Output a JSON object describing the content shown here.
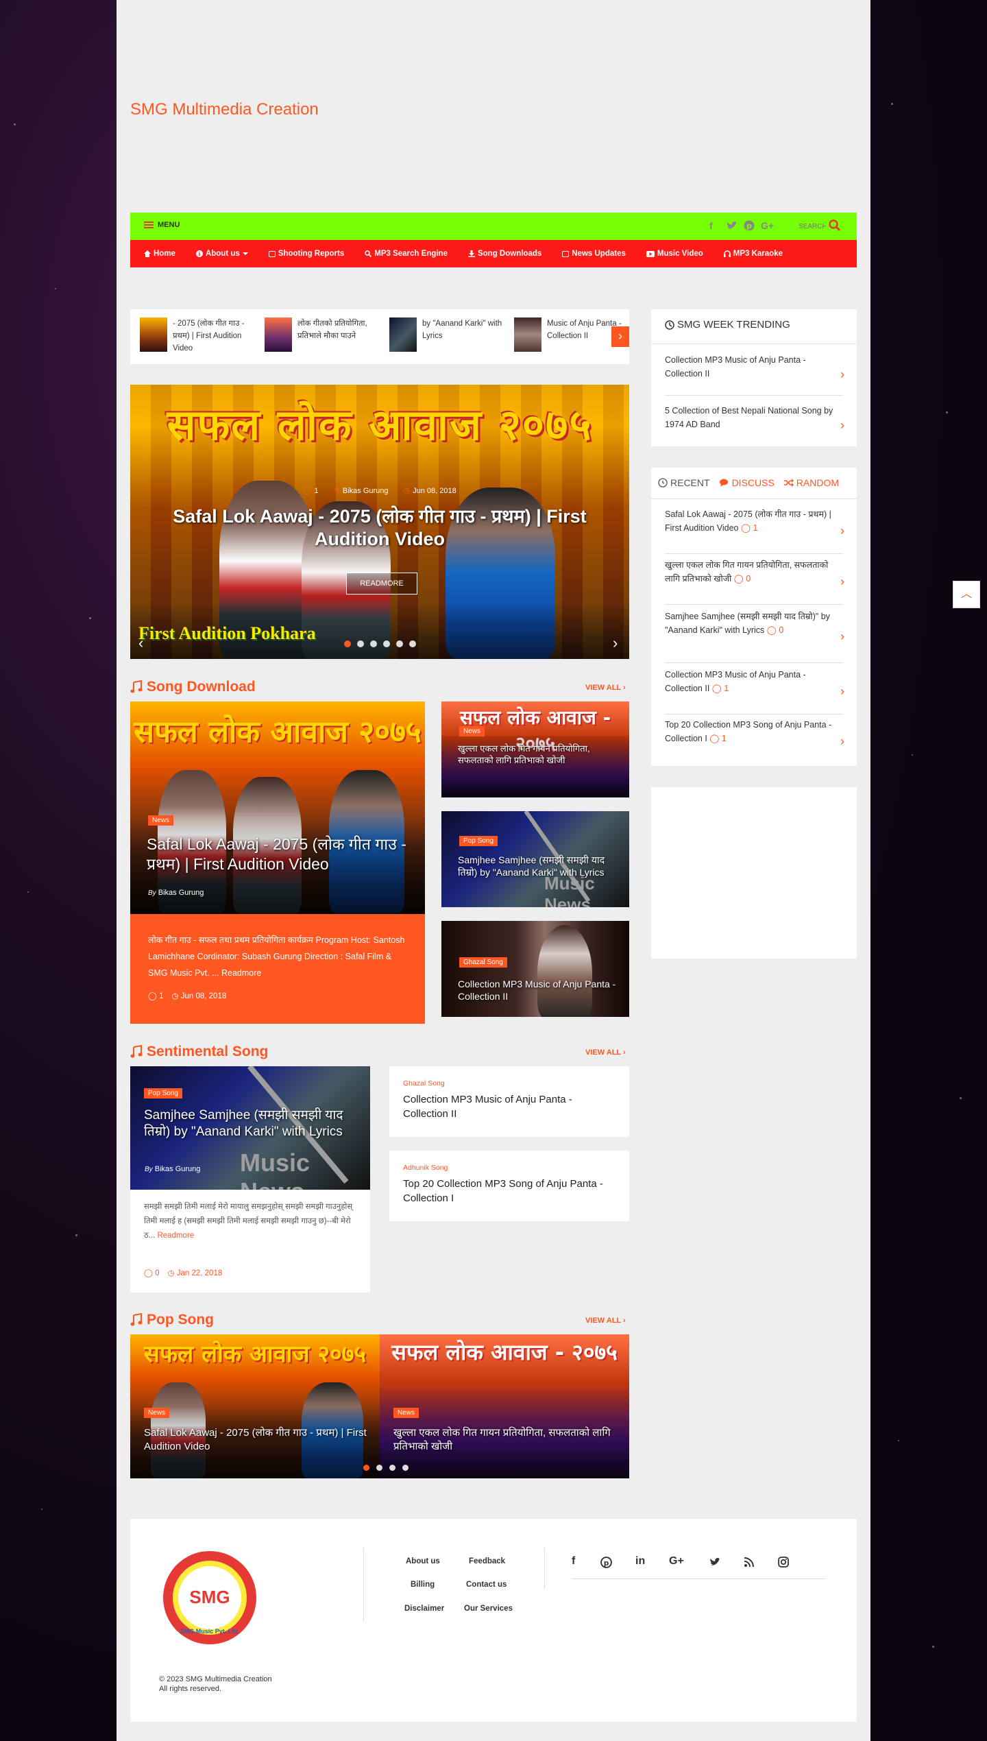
{
  "site": {
    "title": "SMG Multimedia Creation"
  },
  "topbar": {
    "menu_label": "MENU",
    "search_placeholder": "SEARCH",
    "social": [
      "facebook-icon",
      "twitter-icon",
      "pinterest-icon",
      "google-plus-icon"
    ]
  },
  "nav": {
    "items": [
      {
        "label": "Home",
        "icon": "home-icon"
      },
      {
        "label": "About us",
        "icon": "info-icon",
        "dropdown": true
      },
      {
        "label": "Shooting Reports",
        "icon": "camera-icon"
      },
      {
        "label": "MP3 Search Engine",
        "icon": "search-icon"
      },
      {
        "label": "Song Downloads",
        "icon": "download-icon"
      },
      {
        "label": "News Updates",
        "icon": "newspaper-icon"
      },
      {
        "label": "Music Video",
        "icon": "youtube-icon"
      },
      {
        "label": "MP3 Karaoke",
        "icon": "headphones-icon"
      }
    ]
  },
  "ticker": {
    "items": [
      {
        "text": "- 2075 (लोक गीत गाउ - प्रथम) | First Audition Video"
      },
      {
        "text": "लोक गीतको प्रतियोगिता, प्रतिभाले मौका पाउने"
      },
      {
        "text": "by \"Aanand Karki\" with Lyrics"
      },
      {
        "text": "Music of Anju Panta - Collection II"
      }
    ]
  },
  "hero": {
    "image_text": "सफल लोक आवाज २०७५",
    "image_subtext": "First Audition Pokhara",
    "comments": "1",
    "author": "Bikas Gurung",
    "date": "Jun 08, 2018",
    "title": "Safal Lok Aawaj - 2075 (लोक गीत गाउ - प्रथम) | First Audition Video",
    "readmore": "READMORE",
    "dot_count": 6,
    "active_dot": 0
  },
  "song_download": {
    "heading": "Song Download",
    "view_all": "VIEW ALL",
    "main": {
      "badge": "News",
      "title": "Safal Lok Aawaj - 2075 (लोक गीत गाउ - प्रथम) | First Audition Video",
      "by_label": "By",
      "author": "Bikas Gurung",
      "excerpt": "लोक गीत गाउ - सफल तथा प्रथम प्रतियोगिता कार्यक्रम Program Host: Santosh Lamichhane Cordinator: Subash Gurung Direction : Safal Film & SMG Music Pvt. ...",
      "readmore": "Readmore",
      "comments": "1",
      "date": "Jun 08, 2018"
    },
    "side": [
      {
        "badge": "News",
        "title": "खुल्ला एकल लोक गित गायन प्रतियोगिता, सफलताको लागि प्रतिभाको खोजी"
      },
      {
        "badge": "Pop Song",
        "title": "Samjhee Samjhee (समझी समझी याद तिम्रो) by \"Aanand Karki\" with Lyrics"
      },
      {
        "badge": "Ghazal Song",
        "title": "Collection MP3 Music of Anju Panta - Collection II"
      }
    ]
  },
  "sentimental": {
    "heading": "Sentimental Song",
    "view_all": "VIEW ALL",
    "main": {
      "badge": "Pop Song",
      "title": "Samjhee Samjhee (समझी समझी याद तिम्रो) by \"Aanand Karki\" with Lyrics",
      "by_label": "By",
      "author": "Bikas Gurung",
      "excerpt": "समझी समझी तिमी मलाई मेरो मायालु समझनुहोस् समझी समझी गाउनुहोस् तिमी मलाई ह (समझी समझी तिमी मलाई समझी समझी गाउनु छ)--बी मेरो ठ...",
      "readmore": "Readmore",
      "comments": "0",
      "date": "Jan 22, 2018"
    },
    "side": [
      {
        "category": "Ghazal Song",
        "title": "Collection MP3 Music of Anju Panta - Collection II"
      },
      {
        "category": "Adhunik Song",
        "title": "Top 20 Collection MP3 Song of Anju Panta - Collection I"
      }
    ]
  },
  "pop": {
    "heading": "Pop Song",
    "view_all": "VIEW ALL",
    "slides": [
      {
        "badge": "News",
        "title": "Safal Lok Aawaj - 2075 (लोक गीत गाउ - प्रथम) | First Audition Video"
      },
      {
        "badge": "News",
        "title": "खुल्ला एकल लोक गित गायन प्रतियोगिता, सफलताको लागि प्रतिभाको खोजी"
      }
    ],
    "dot_count": 4,
    "active_dot": 0
  },
  "sidebar": {
    "trending_heading": "SMG WEEK TRENDING",
    "trending": [
      {
        "title": "Collection MP3 Music of Anju Panta - Collection II"
      },
      {
        "title": "5 Collection of Best Nepali National Song by 1974 AD Band"
      }
    ],
    "tabs": {
      "recent": "RECENT",
      "discuss": "DISCUSS",
      "random": "RANDOM"
    },
    "recent": [
      {
        "title": "Safal Lok Aawaj - 2075 (लोक गीत गाउ - प्रथम) | First Audition Video",
        "comments": "1"
      },
      {
        "title": "खुल्ला एकल लोक गित गायन प्रतियोगिता, सफलताको लागि प्रतिभाको खोजी",
        "comments": "0"
      },
      {
        "title": "Samjhee Samjhee (समझी समझी याद तिम्रो)\" by \"Aanand Karki\" with Lyrics",
        "comments": "0"
      },
      {
        "title": "Collection MP3 Music of Anju Panta - Collection II",
        "comments": "1"
      },
      {
        "title": "Top 20 Collection MP3 Song of Anju Panta - Collection I",
        "comments": "1"
      }
    ]
  },
  "footer": {
    "logo_text": "SMG",
    "logo_ring_text": "SMG Music Pvt. Ltd.",
    "links": [
      "About us",
      "Feedback",
      "Billing",
      "Contact us",
      "Disclaimer",
      "Our Services"
    ],
    "social": [
      "facebook-icon",
      "pinterest-icon",
      "linkedin-icon",
      "google-plus-icon",
      "twitter-icon",
      "rss-icon",
      "instagram-icon"
    ],
    "copyright": "© 2023 SMG Multimedia Creation",
    "rights": "All rights reserved."
  },
  "colors": {
    "accent": "#ff5722",
    "topbar": "#76ff03",
    "navbar": "#ff1a1a"
  }
}
